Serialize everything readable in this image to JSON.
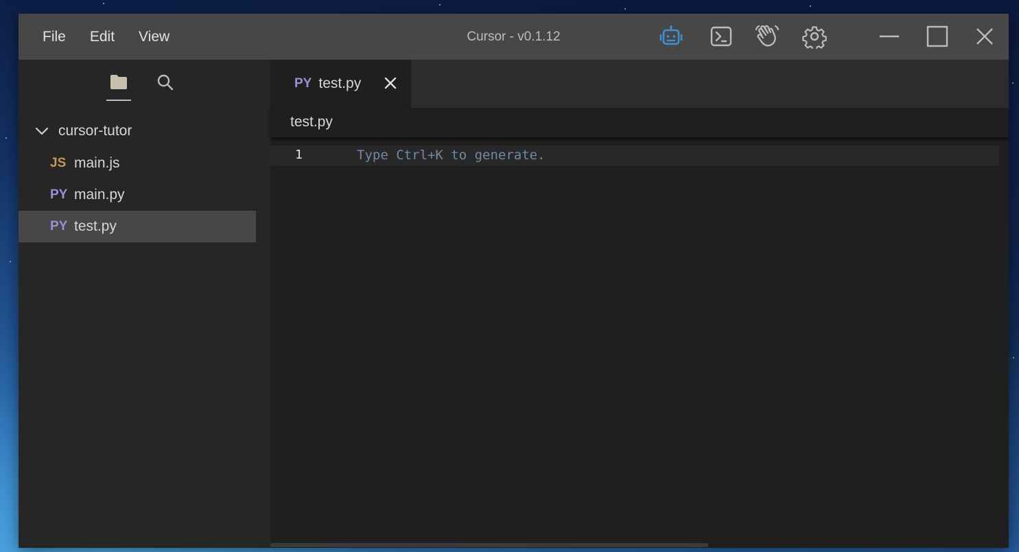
{
  "menu": {
    "file": "File",
    "edit": "Edit",
    "view": "View"
  },
  "window": {
    "title": "Cursor - v0.1.12"
  },
  "toolbar_icons": [
    "robot-icon",
    "terminal-icon",
    "waving-hand-icon",
    "gear-icon"
  ],
  "window_controls": [
    "minimize-icon",
    "maximize-icon",
    "close-icon"
  ],
  "colors": {
    "accent_blue": "#3f8fd2",
    "js_badge": "#c49a5a",
    "py_badge": "#9b8fd8",
    "selected_row": "#474747"
  },
  "sidebar": {
    "folder": "cursor-tutor",
    "files": [
      {
        "badge": "JS",
        "name": "main.js"
      },
      {
        "badge": "PY",
        "name": "main.py"
      },
      {
        "badge": "PY",
        "name": "test.py"
      }
    ]
  },
  "editor": {
    "tab": {
      "badge": "PY",
      "name": "test.py"
    },
    "breadcrumb": "test.py",
    "line_number": "1",
    "placeholder": "Type Ctrl+K to generate."
  }
}
